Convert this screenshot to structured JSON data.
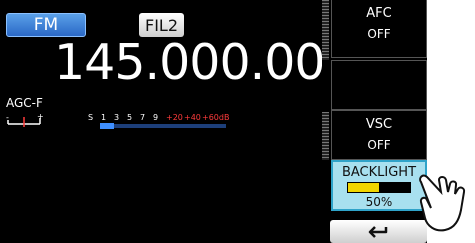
{
  "mode_label": "FM",
  "filter_label": "FIL2",
  "frequency": "145.000.00",
  "agc_label": "AGC-F",
  "meter": {
    "scale": [
      "S",
      "1",
      "3",
      "5",
      "7",
      "9",
      "+20",
      "+40",
      "+60dB"
    ]
  },
  "side": {
    "afc": {
      "label": "AFC",
      "value": "OFF"
    },
    "vsc": {
      "label": "VSC",
      "value": "OFF"
    },
    "backlight": {
      "label": "BACKLIGHT",
      "value": "50%",
      "level": 0.5
    }
  },
  "colors": {
    "accent": "#2fa3c9",
    "level_bar": "#f2d600",
    "meter_blue": "#3f8fff",
    "meter_red": "#ff3b3b"
  },
  "icons": {
    "back": "return-arrow-icon",
    "hand": "pointing-hand-icon"
  }
}
